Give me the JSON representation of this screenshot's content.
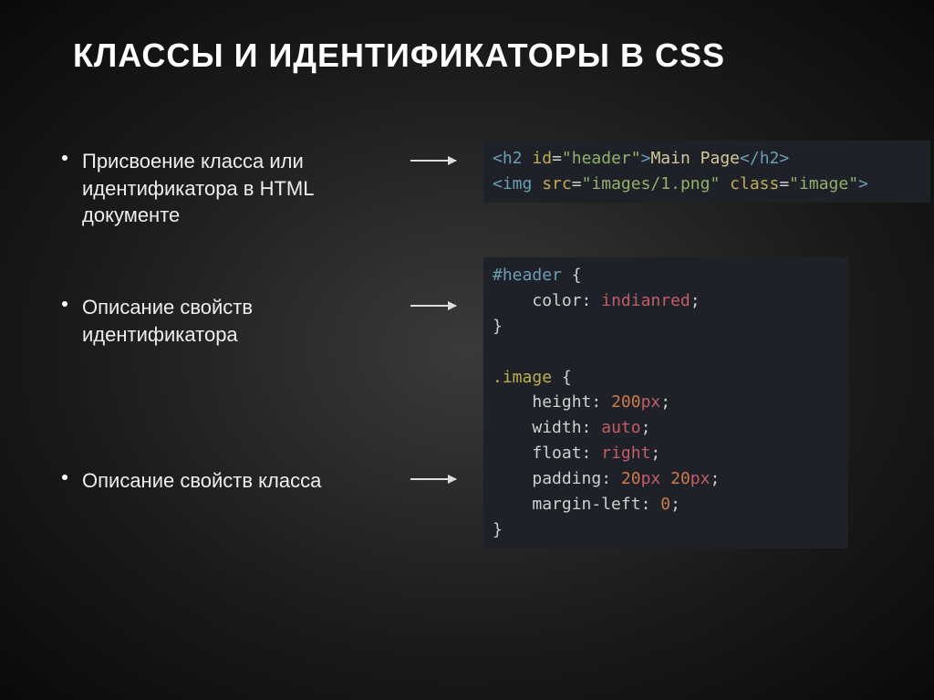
{
  "title": "КЛАССЫ И ИДЕНТИФИКАТОРЫ В CSS",
  "bullets": [
    "Присвоение класса или идентификатора в HTML документе",
    "Описание свойств идентификатора",
    "Описание свойств класса"
  ],
  "code1": {
    "line1": {
      "open_lt": "<",
      "tag_h2": "h2",
      "sp": " ",
      "attr_id": "id",
      "eq": "=",
      "q": "\"",
      "val_header": "header",
      "gt": ">",
      "text_main": "Main Page",
      "close_lt": "</",
      "tag_h2c": "h2",
      "cgt": ">"
    },
    "line2": {
      "open_lt": "<",
      "tag_img": "img",
      "sp": " ",
      "attr_src": "src",
      "eq": "=",
      "q": "\"",
      "val_src": "images/1.png",
      "attr_class": "class",
      "val_class": "image",
      "gt": ">"
    }
  },
  "code2": {
    "sel_header_hash": "#",
    "sel_header": "header",
    "brace_o": " {",
    "brace_c": "}",
    "prop_color": "color",
    "colon": ":",
    "val_indianred": " indianred",
    "semi": ";",
    "sel_image_dot": ".",
    "sel_image": "image",
    "prop_height": "height",
    "val_200": " 200",
    "unit_px": "px",
    "prop_width": "width",
    "val_auto": " auto",
    "prop_float": "float",
    "val_right": " right",
    "prop_padding": "padding",
    "val_20a": " 20",
    "val_20b": " 20",
    "prop_margin_left": "margin-left",
    "val_0": " 0"
  }
}
